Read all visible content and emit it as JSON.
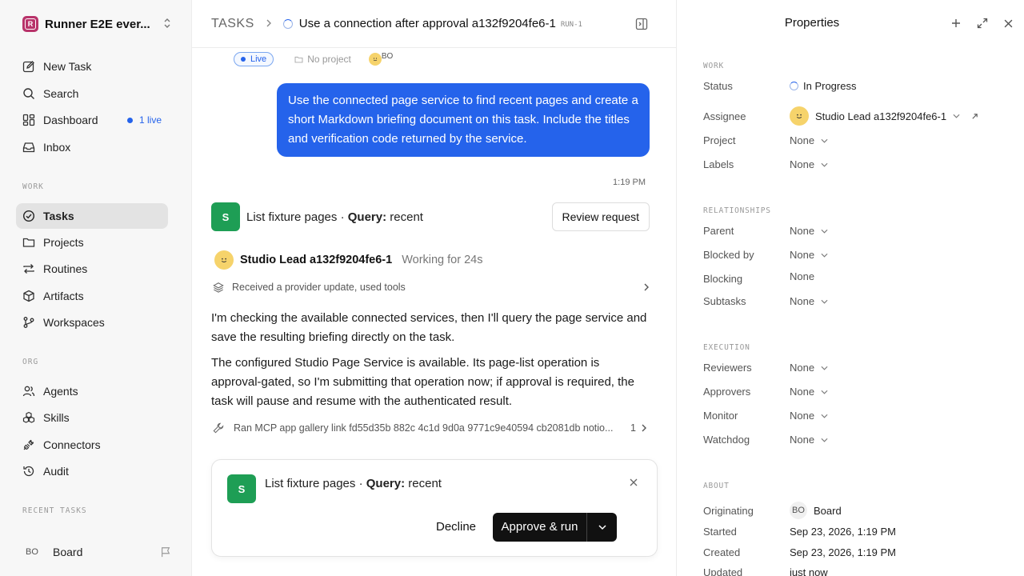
{
  "sidebar": {
    "workspace_name": "Runner E2E ever...",
    "workspace_initial": "R",
    "nav_top": [
      {
        "label": "New Task"
      },
      {
        "label": "Search"
      },
      {
        "label": "Dashboard",
        "badge": "1 live"
      },
      {
        "label": "Inbox"
      }
    ],
    "work_label": "WORK",
    "work_items": [
      {
        "label": "Tasks"
      },
      {
        "label": "Projects"
      },
      {
        "label": "Routines"
      },
      {
        "label": "Artifacts"
      },
      {
        "label": "Workspaces"
      }
    ],
    "org_label": "ORG",
    "org_items": [
      {
        "label": "Agents"
      },
      {
        "label": "Skills"
      },
      {
        "label": "Connectors"
      },
      {
        "label": "Audit"
      }
    ],
    "recent_label": "RECENT TASKS",
    "footer": {
      "initials": "BO",
      "name": "Board"
    }
  },
  "header": {
    "breadcrumb_root": "TASKS",
    "task_title": "Use a connection after approval a132f9204fe6-1",
    "run_label": "RUN-1"
  },
  "meta": {
    "live": "Live",
    "project": "No project",
    "owner_initials": "BO"
  },
  "conversation": {
    "user_message": "Use the connected page service to find recent pages and create a short Markdown briefing document on this task. Include the titles and verification code returned by the service.",
    "user_time": "1:19 PM",
    "tool_request": {
      "badge": "S",
      "name": "List fixture pages",
      "separator": " · ",
      "query_label": "Query:",
      "query_value": " recent",
      "review_label": "Review request"
    },
    "agent": {
      "name": "Studio Lead a132f9204fe6-1",
      "status": "Working for 24s"
    },
    "update_text": "Received a provider update, used tools",
    "para1": "I'm checking the available connected services, then I'll query the page service and save the resulting briefing directly on the task.",
    "para2": "The configured Studio Page Service is available. Its page-list operation is approval-gated, so I'm submitting that operation now; if approval is required, the task will pause and resume with the authenticated result.",
    "ran_text": "Ran MCP app gallery link fd55d35b 882c 4c1d 9d0a 9771c9e40594 cb2081db notio...",
    "ran_count": "1"
  },
  "approval": {
    "badge": "S",
    "name": "List fixture pages",
    "separator": " · ",
    "query_label": "Query:",
    "query_value": " recent",
    "decline_label": "Decline",
    "approve_label": "Approve & run"
  },
  "properties": {
    "title": "Properties",
    "work_label": "WORK",
    "status_key": "Status",
    "status_value": "In Progress",
    "assignee_key": "Assignee",
    "assignee_value": "Studio Lead a132f9204fe6-1",
    "project_key": "Project",
    "project_value": "None",
    "labels_key": "Labels",
    "labels_value": "None",
    "relationships_label": "RELATIONSHIPS",
    "parent_key": "Parent",
    "parent_value": "None",
    "blocked_by_key": "Blocked by",
    "blocked_by_value": "None",
    "blocking_key": "Blocking",
    "blocking_value": "None",
    "subtasks_key": "Subtasks",
    "subtasks_value": "None",
    "execution_label": "EXECUTION",
    "reviewers_key": "Reviewers",
    "reviewers_value": "None",
    "approvers_key": "Approvers",
    "approvers_value": "None",
    "monitor_key": "Monitor",
    "monitor_value": "None",
    "watchdog_key": "Watchdog",
    "watchdog_value": "None",
    "about_label": "ABOUT",
    "originating_key": "Originating",
    "originating_initials": "BO",
    "originating_value": "Board",
    "started_key": "Started",
    "started_value": "Sep 23, 2026, 1:19 PM",
    "created_key": "Created",
    "created_value": "Sep 23, 2026, 1:19 PM",
    "updated_key": "Updated",
    "updated_value": "just now"
  },
  "colors": {
    "accent": "#2563eb",
    "tool_green": "#1e9e55",
    "brand": "#b8336a"
  }
}
